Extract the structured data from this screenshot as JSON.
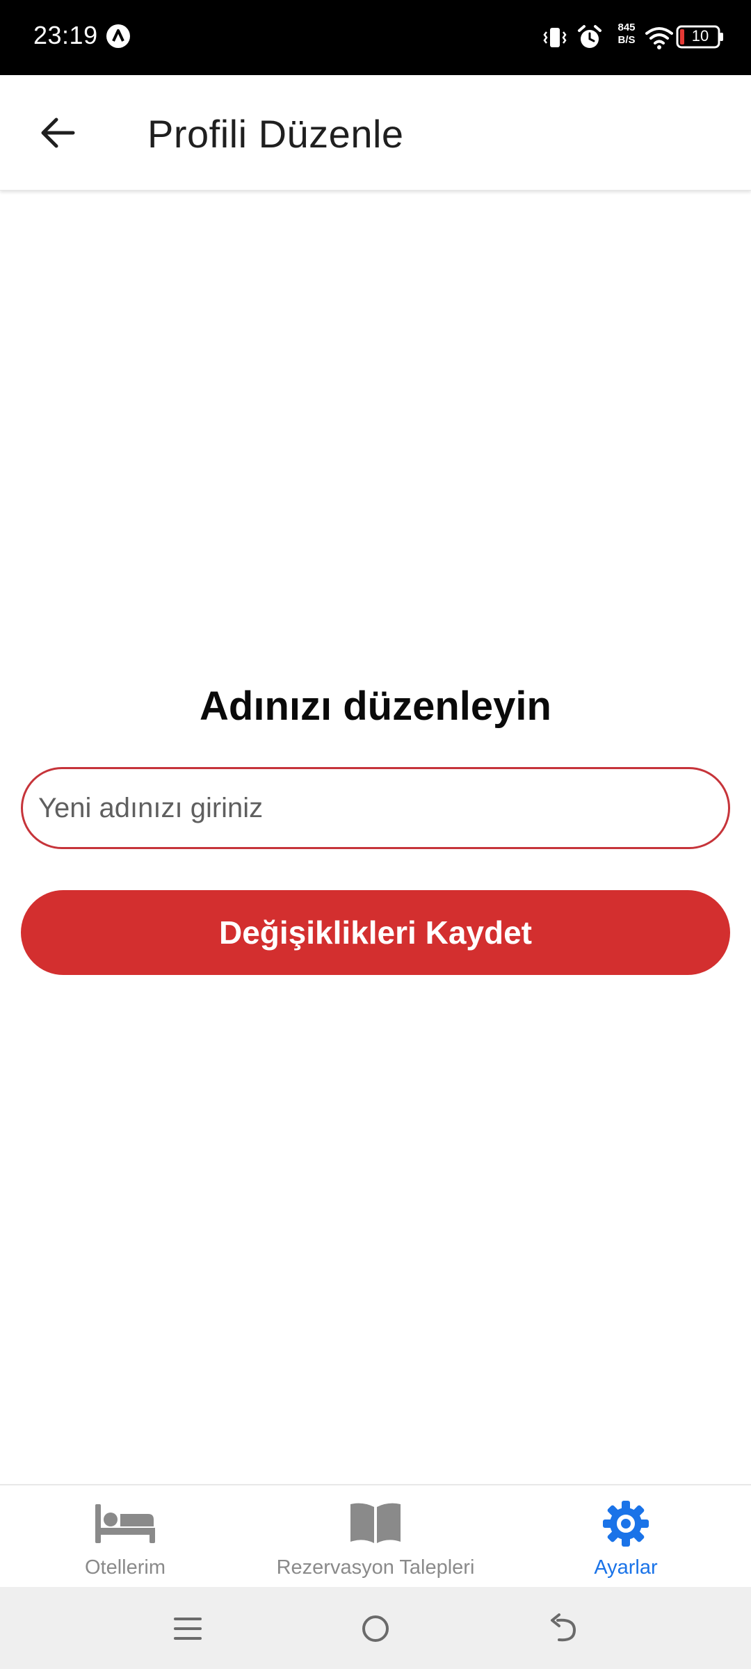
{
  "status_bar": {
    "time": "23:19",
    "net_speed_value": "845",
    "net_speed_unit": "B/S",
    "battery_level": "10",
    "icons": [
      "app-notification-icon",
      "vibrate-icon",
      "alarm-icon",
      "wifi-icon",
      "battery-icon"
    ]
  },
  "app_bar": {
    "title": "Profili Düzenle",
    "back_icon": "arrow-left-icon"
  },
  "form": {
    "heading": "Adınızı düzenleyin",
    "name_input": {
      "value": "",
      "placeholder": "Yeni adınızı giriniz"
    },
    "save_label": "Değişiklikleri Kaydet"
  },
  "bottom_nav": {
    "items": [
      {
        "label": "Otellerim",
        "icon": "bed-icon",
        "active": false
      },
      {
        "label": "Rezervasyon Talepleri",
        "icon": "book-icon",
        "active": false
      },
      {
        "label": "Ayarlar",
        "icon": "gear-icon",
        "active": true
      }
    ]
  },
  "system_nav": {
    "icons": [
      "menu-icon",
      "home-icon",
      "back-icon"
    ]
  },
  "colors": {
    "accent": "#d32f2f",
    "input_border": "#c6343a",
    "nav_active": "#1a73e8",
    "nav_inactive": "#8a8a8a",
    "status_bar": "#000000"
  }
}
